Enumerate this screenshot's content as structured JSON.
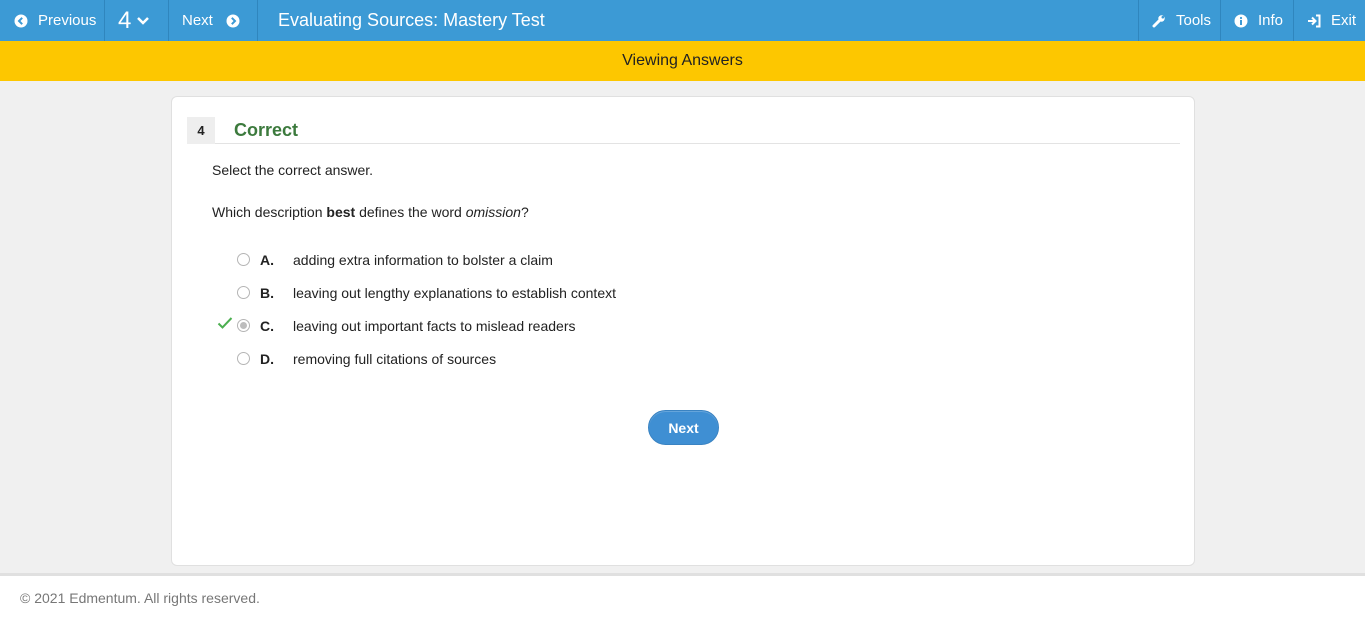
{
  "topbar": {
    "prev_label": "Previous",
    "question_number": "4",
    "next_label": "Next",
    "title": "Evaluating Sources: Mastery Test",
    "tools_label": "Tools",
    "info_label": "Info",
    "exit_label": "Exit",
    "bg_color": "#3c9ad5"
  },
  "banner": {
    "text": "Viewing Answers",
    "bg_color": "#fdc700"
  },
  "question": {
    "number": "4",
    "status": "Correct",
    "status_color": "#3c7a3d",
    "instruction": "Select the correct answer.",
    "prompt_before": "Which description ",
    "prompt_bold": "best",
    "prompt_middle": " defines the word ",
    "prompt_italic": "omission",
    "prompt_after": "?",
    "choices": [
      {
        "letter": "A.",
        "text": "adding extra information to bolster a claim",
        "selected": false
      },
      {
        "letter": "B.",
        "text": "leaving out lengthy explanations to establish context",
        "selected": false
      },
      {
        "letter": "C.",
        "text": "leaving out important facts to mislead readers",
        "selected": true,
        "correct_mark": "check-icon"
      },
      {
        "letter": "D.",
        "text": "removing full citations of sources",
        "selected": false
      }
    ],
    "next_button": "Next"
  },
  "footer": {
    "copyright": "© 2021 Edmentum. All rights reserved."
  }
}
